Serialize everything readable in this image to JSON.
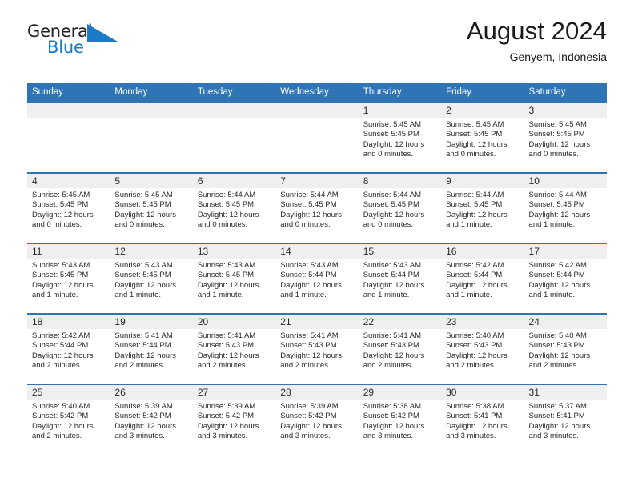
{
  "logo": {
    "word_top": "General",
    "word_bottom": "Blue",
    "triangle_color": "#1b7ac4",
    "text_color": "#231f20"
  },
  "header": {
    "title": "August 2024",
    "location": "Genyem, Indonesia"
  },
  "colors": {
    "header_blue": "#2f74b5",
    "day_band_gray": "#efefef",
    "text": "#2a2a2a",
    "page_background": "#ffffff"
  },
  "calendar": {
    "weekday_headers": [
      "Sunday",
      "Monday",
      "Tuesday",
      "Wednesday",
      "Thursday",
      "Friday",
      "Saturday"
    ],
    "weeks": [
      [
        {
          "day": "",
          "sunrise": "",
          "sunset": "",
          "daylight_line1": "",
          "daylight_line2": "",
          "empty": true
        },
        {
          "day": "",
          "sunrise": "",
          "sunset": "",
          "daylight_line1": "",
          "daylight_line2": "",
          "empty": true
        },
        {
          "day": "",
          "sunrise": "",
          "sunset": "",
          "daylight_line1": "",
          "daylight_line2": "",
          "empty": true
        },
        {
          "day": "",
          "sunrise": "",
          "sunset": "",
          "daylight_line1": "",
          "daylight_line2": "",
          "empty": true
        },
        {
          "day": "1",
          "sunrise": "Sunrise: 5:45 AM",
          "sunset": "Sunset: 5:45 PM",
          "daylight_line1": "Daylight: 12 hours",
          "daylight_line2": "and 0 minutes.",
          "empty": false
        },
        {
          "day": "2",
          "sunrise": "Sunrise: 5:45 AM",
          "sunset": "Sunset: 5:45 PM",
          "daylight_line1": "Daylight: 12 hours",
          "daylight_line2": "and 0 minutes.",
          "empty": false
        },
        {
          "day": "3",
          "sunrise": "Sunrise: 5:45 AM",
          "sunset": "Sunset: 5:45 PM",
          "daylight_line1": "Daylight: 12 hours",
          "daylight_line2": "and 0 minutes.",
          "empty": false
        }
      ],
      [
        {
          "day": "4",
          "sunrise": "Sunrise: 5:45 AM",
          "sunset": "Sunset: 5:45 PM",
          "daylight_line1": "Daylight: 12 hours",
          "daylight_line2": "and 0 minutes.",
          "empty": false
        },
        {
          "day": "5",
          "sunrise": "Sunrise: 5:45 AM",
          "sunset": "Sunset: 5:45 PM",
          "daylight_line1": "Daylight: 12 hours",
          "daylight_line2": "and 0 minutes.",
          "empty": false
        },
        {
          "day": "6",
          "sunrise": "Sunrise: 5:44 AM",
          "sunset": "Sunset: 5:45 PM",
          "daylight_line1": "Daylight: 12 hours",
          "daylight_line2": "and 0 minutes.",
          "empty": false
        },
        {
          "day": "7",
          "sunrise": "Sunrise: 5:44 AM",
          "sunset": "Sunset: 5:45 PM",
          "daylight_line1": "Daylight: 12 hours",
          "daylight_line2": "and 0 minutes.",
          "empty": false
        },
        {
          "day": "8",
          "sunrise": "Sunrise: 5:44 AM",
          "sunset": "Sunset: 5:45 PM",
          "daylight_line1": "Daylight: 12 hours",
          "daylight_line2": "and 0 minutes.",
          "empty": false
        },
        {
          "day": "9",
          "sunrise": "Sunrise: 5:44 AM",
          "sunset": "Sunset: 5:45 PM",
          "daylight_line1": "Daylight: 12 hours",
          "daylight_line2": "and 1 minute.",
          "empty": false
        },
        {
          "day": "10",
          "sunrise": "Sunrise: 5:44 AM",
          "sunset": "Sunset: 5:45 PM",
          "daylight_line1": "Daylight: 12 hours",
          "daylight_line2": "and 1 minute.",
          "empty": false
        }
      ],
      [
        {
          "day": "11",
          "sunrise": "Sunrise: 5:43 AM",
          "sunset": "Sunset: 5:45 PM",
          "daylight_line1": "Daylight: 12 hours",
          "daylight_line2": "and 1 minute.",
          "empty": false
        },
        {
          "day": "12",
          "sunrise": "Sunrise: 5:43 AM",
          "sunset": "Sunset: 5:45 PM",
          "daylight_line1": "Daylight: 12 hours",
          "daylight_line2": "and 1 minute.",
          "empty": false
        },
        {
          "day": "13",
          "sunrise": "Sunrise: 5:43 AM",
          "sunset": "Sunset: 5:45 PM",
          "daylight_line1": "Daylight: 12 hours",
          "daylight_line2": "and 1 minute.",
          "empty": false
        },
        {
          "day": "14",
          "sunrise": "Sunrise: 5:43 AM",
          "sunset": "Sunset: 5:44 PM",
          "daylight_line1": "Daylight: 12 hours",
          "daylight_line2": "and 1 minute.",
          "empty": false
        },
        {
          "day": "15",
          "sunrise": "Sunrise: 5:43 AM",
          "sunset": "Sunset: 5:44 PM",
          "daylight_line1": "Daylight: 12 hours",
          "daylight_line2": "and 1 minute.",
          "empty": false
        },
        {
          "day": "16",
          "sunrise": "Sunrise: 5:42 AM",
          "sunset": "Sunset: 5:44 PM",
          "daylight_line1": "Daylight: 12 hours",
          "daylight_line2": "and 1 minute.",
          "empty": false
        },
        {
          "day": "17",
          "sunrise": "Sunrise: 5:42 AM",
          "sunset": "Sunset: 5:44 PM",
          "daylight_line1": "Daylight: 12 hours",
          "daylight_line2": "and 1 minute.",
          "empty": false
        }
      ],
      [
        {
          "day": "18",
          "sunrise": "Sunrise: 5:42 AM",
          "sunset": "Sunset: 5:44 PM",
          "daylight_line1": "Daylight: 12 hours",
          "daylight_line2": "and 2 minutes.",
          "empty": false
        },
        {
          "day": "19",
          "sunrise": "Sunrise: 5:41 AM",
          "sunset": "Sunset: 5:44 PM",
          "daylight_line1": "Daylight: 12 hours",
          "daylight_line2": "and 2 minutes.",
          "empty": false
        },
        {
          "day": "20",
          "sunrise": "Sunrise: 5:41 AM",
          "sunset": "Sunset: 5:43 PM",
          "daylight_line1": "Daylight: 12 hours",
          "daylight_line2": "and 2 minutes.",
          "empty": false
        },
        {
          "day": "21",
          "sunrise": "Sunrise: 5:41 AM",
          "sunset": "Sunset: 5:43 PM",
          "daylight_line1": "Daylight: 12 hours",
          "daylight_line2": "and 2 minutes.",
          "empty": false
        },
        {
          "day": "22",
          "sunrise": "Sunrise: 5:41 AM",
          "sunset": "Sunset: 5:43 PM",
          "daylight_line1": "Daylight: 12 hours",
          "daylight_line2": "and 2 minutes.",
          "empty": false
        },
        {
          "day": "23",
          "sunrise": "Sunrise: 5:40 AM",
          "sunset": "Sunset: 5:43 PM",
          "daylight_line1": "Daylight: 12 hours",
          "daylight_line2": "and 2 minutes.",
          "empty": false
        },
        {
          "day": "24",
          "sunrise": "Sunrise: 5:40 AM",
          "sunset": "Sunset: 5:43 PM",
          "daylight_line1": "Daylight: 12 hours",
          "daylight_line2": "and 2 minutes.",
          "empty": false
        }
      ],
      [
        {
          "day": "25",
          "sunrise": "Sunrise: 5:40 AM",
          "sunset": "Sunset: 5:42 PM",
          "daylight_line1": "Daylight: 12 hours",
          "daylight_line2": "and 2 minutes.",
          "empty": false
        },
        {
          "day": "26",
          "sunrise": "Sunrise: 5:39 AM",
          "sunset": "Sunset: 5:42 PM",
          "daylight_line1": "Daylight: 12 hours",
          "daylight_line2": "and 3 minutes.",
          "empty": false
        },
        {
          "day": "27",
          "sunrise": "Sunrise: 5:39 AM",
          "sunset": "Sunset: 5:42 PM",
          "daylight_line1": "Daylight: 12 hours",
          "daylight_line2": "and 3 minutes.",
          "empty": false
        },
        {
          "day": "28",
          "sunrise": "Sunrise: 5:39 AM",
          "sunset": "Sunset: 5:42 PM",
          "daylight_line1": "Daylight: 12 hours",
          "daylight_line2": "and 3 minutes.",
          "empty": false
        },
        {
          "day": "29",
          "sunrise": "Sunrise: 5:38 AM",
          "sunset": "Sunset: 5:42 PM",
          "daylight_line1": "Daylight: 12 hours",
          "daylight_line2": "and 3 minutes.",
          "empty": false
        },
        {
          "day": "30",
          "sunrise": "Sunrise: 5:38 AM",
          "sunset": "Sunset: 5:41 PM",
          "daylight_line1": "Daylight: 12 hours",
          "daylight_line2": "and 3 minutes.",
          "empty": false
        },
        {
          "day": "31",
          "sunrise": "Sunrise: 5:37 AM",
          "sunset": "Sunset: 5:41 PM",
          "daylight_line1": "Daylight: 12 hours",
          "daylight_line2": "and 3 minutes.",
          "empty": false
        }
      ]
    ]
  }
}
